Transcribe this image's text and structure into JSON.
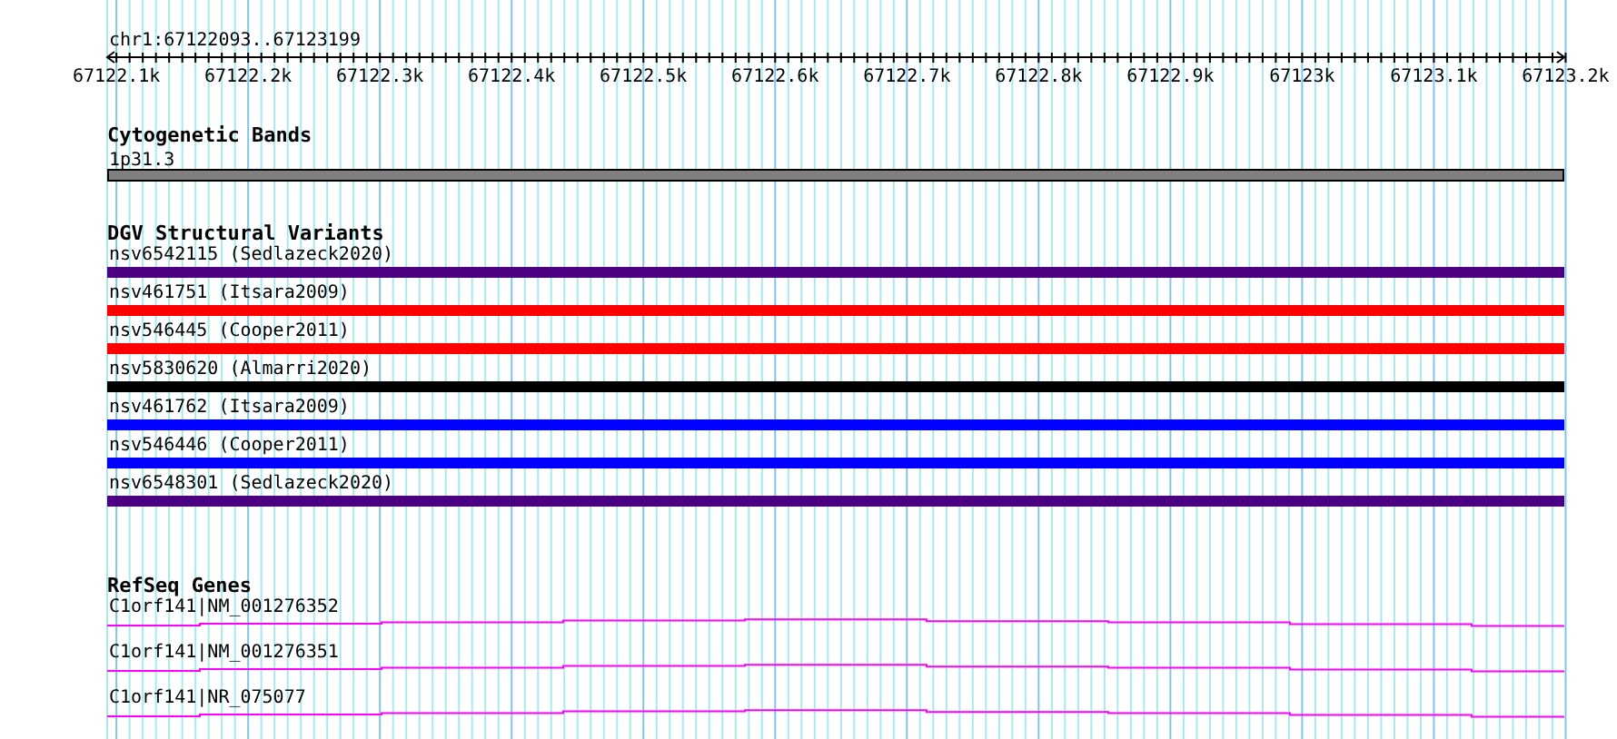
{
  "ruler": {
    "range_label": "chr1:67122093..67123199",
    "tick_labels": [
      "67122.1k",
      "67122.2k",
      "67122.3k",
      "67122.4k",
      "67122.5k",
      "67122.6k",
      "67122.7k",
      "67122.8k",
      "67122.9k",
      "67123k",
      "67123.1k",
      "67123.2k"
    ]
  },
  "cytogenetic_bands": {
    "title": "Cytogenetic Bands",
    "features": [
      {
        "label": "1p31.3"
      }
    ]
  },
  "dgv_structural_variants": {
    "title": "DGV Structural Variants",
    "features": [
      {
        "label": "nsv6542115 (Sedlazeck2020)",
        "color": "#4b0082"
      },
      {
        "label": "nsv461751 (Itsara2009)",
        "color": "#ff0000"
      },
      {
        "label": "nsv546445 (Cooper2011)",
        "color": "#ff0000"
      },
      {
        "label": "nsv5830620 (Almarri2020)",
        "color": "#000000"
      },
      {
        "label": "nsv461762 (Itsara2009)",
        "color": "#0000ff"
      },
      {
        "label": "nsv546446 (Cooper2011)",
        "color": "#0000ff"
      },
      {
        "label": "nsv6548301 (Sedlazeck2020)",
        "color": "#4b0082"
      }
    ]
  },
  "refseq_genes": {
    "title": "RefSeq Genes",
    "features": [
      {
        "label": "C1orf141|NM_001276352"
      },
      {
        "label": "C1orf141|NM_001276351"
      },
      {
        "label": "C1orf141|NR_075077"
      }
    ]
  }
}
